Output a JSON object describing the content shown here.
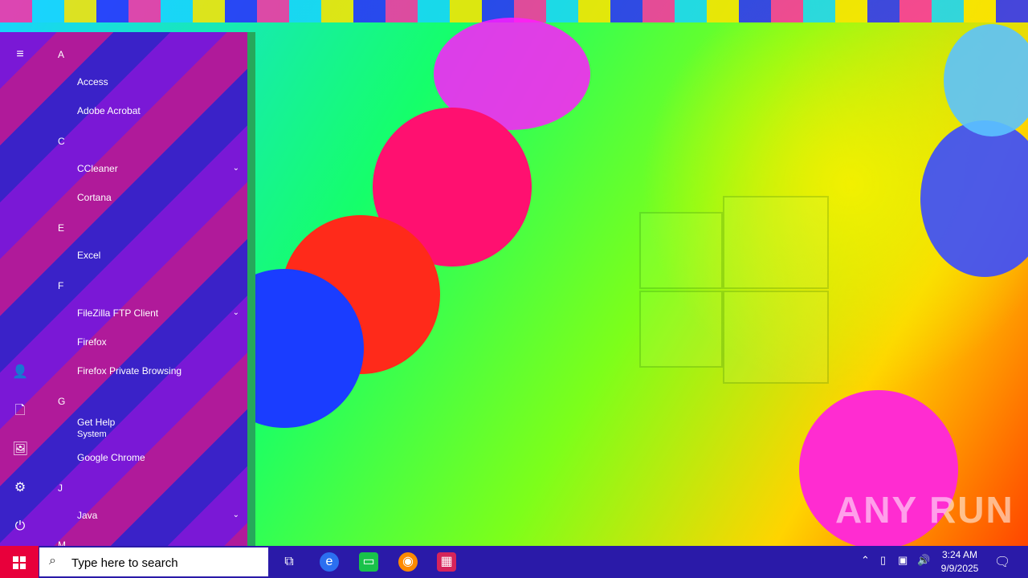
{
  "start_menu": {
    "groups": [
      {
        "letter": "A",
        "items": [
          {
            "label": "Access"
          },
          {
            "label": "Adobe Acrobat"
          }
        ]
      },
      {
        "letter": "C",
        "items": [
          {
            "label": "CCleaner",
            "expandable": true
          },
          {
            "label": "Cortana"
          }
        ]
      },
      {
        "letter": "E",
        "items": [
          {
            "label": "Excel"
          }
        ]
      },
      {
        "letter": "F",
        "items": [
          {
            "label": "FileZilla FTP Client",
            "expandable": true
          },
          {
            "label": "Firefox"
          },
          {
            "label": "Firefox Private Browsing"
          }
        ]
      },
      {
        "letter": "G",
        "items": [
          {
            "label": "Get Help",
            "sublabel": "System"
          },
          {
            "label": "Google Chrome"
          }
        ]
      },
      {
        "letter": "J",
        "items": [
          {
            "label": "Java",
            "expandable": true
          }
        ]
      },
      {
        "letter": "M",
        "items": []
      }
    ],
    "rail_icons": [
      "hamburger-icon",
      "user-icon",
      "document-icon",
      "pictures-icon",
      "settings-icon",
      "power-icon"
    ]
  },
  "taskbar": {
    "search_placeholder": "Type here to search",
    "pinned_icons": [
      "task-view-icon",
      "edge-icon",
      "file-explorer-icon",
      "firefox-icon",
      "winrar-icon"
    ],
    "tray_icons": [
      "chevron-up-icon",
      "battery-icon",
      "network-icon",
      "volume-icon"
    ],
    "time": "3:24 AM",
    "date": "9/9/2025"
  },
  "watermark": "ANY RUN",
  "colors": {
    "taskbar": "#2a1aa8",
    "start_button": "#e8003b"
  }
}
